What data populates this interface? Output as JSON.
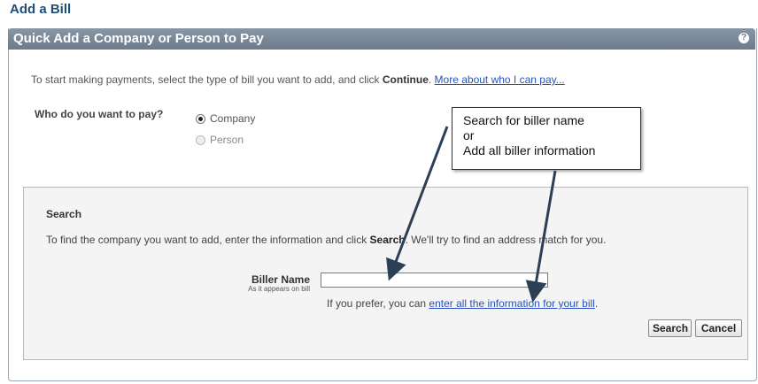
{
  "page": {
    "title": "Add a Bill"
  },
  "panel": {
    "title": "Quick Add a Company or Person to Pay",
    "help_icon": "?"
  },
  "intro": {
    "text": "To start making payments, select the type of bill you want to add, and click ",
    "bold": "Continue",
    "suffix": ". ",
    "link": "More about who I can pay..."
  },
  "who": {
    "label": "Who do you want to pay?",
    "options": [
      {
        "label": "Company",
        "selected": true,
        "enabled": true
      },
      {
        "label": "Person",
        "selected": false,
        "enabled": false
      }
    ]
  },
  "callout": {
    "line1": "Search for biller name",
    "line2": "or",
    "line3": "Add all biller information"
  },
  "search": {
    "heading": "Search",
    "desc_pre": "To find the company you want to add, enter the information and click ",
    "desc_bold": "Search",
    "desc_post": ". We'll try to find an address match for you.",
    "biller_label": "Biller Name",
    "biller_sublabel": "As it appears on bill",
    "biller_value": "",
    "prefer_text": "If you prefer, you can ",
    "prefer_link": "enter all the information for your bill",
    "prefer_end": ".",
    "search_button": "Search",
    "cancel_button": "Cancel"
  },
  "colors": {
    "header": "#6c7b8b",
    "title": "#1f4e79",
    "link": "#2a52be"
  }
}
